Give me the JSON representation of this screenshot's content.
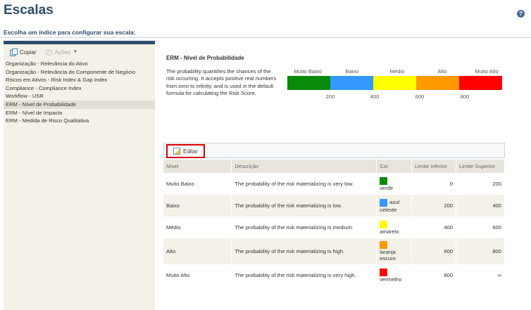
{
  "header": {
    "title": "Escalas",
    "subtitle": "Escolha um índice para configurar sua escala:",
    "help_glyph": "?"
  },
  "toolbar": {
    "copy_label": "Copiar",
    "actions_label": "Ações",
    "actions_glyph": "»",
    "caret_glyph": "▼"
  },
  "sidebar": {
    "items": [
      "Organização - Relevância do Ativo",
      "Organização - Relevância do Componente de Negócio",
      "Riscos em Ativos - Risk Index & Gap Index",
      "Compliance - Compliance Index",
      "Workflow - USR",
      "ERM - Nível de Probabilidade",
      "ERM - Nível de Impacto",
      "ERM - Medida de Risco Qualitativa"
    ],
    "selected_index": 5
  },
  "scale": {
    "title": "ERM - Nível de Probabilidade",
    "description": "The probability quantifies the chances of the risk occurring. It accepts positive real numbers from zero to infinity, and is used in the default formula for calculating the Risk Score.",
    "labels": [
      "Muito Baixo",
      "Baixo",
      "Médio",
      "Alto",
      "Muito Alto"
    ],
    "colors": [
      "#0a8a0a",
      "#3399ff",
      "#ffff00",
      "#ff9900",
      "#ff0000"
    ],
    "ticks": [
      "200",
      "400",
      "600",
      "800"
    ]
  },
  "grid": {
    "edit_label": "Editar",
    "columns": [
      "Nível",
      "Descrição",
      "Cor",
      "Limite Inferior",
      "Limite Superior"
    ],
    "rows": [
      {
        "level": "Muito Baixo",
        "description": "The probability of the risk materializing is very low.",
        "color_name": "verde",
        "color_hex": "#0a8a0a",
        "lower": "0",
        "upper": "200"
      },
      {
        "level": "Baixo",
        "description": "The probability of the risk materializing is low.",
        "color_name": "azul celeste",
        "color_hex": "#3399ff",
        "lower": "200",
        "upper": "400"
      },
      {
        "level": "Médio",
        "description": "The probability of the risk materializing is medium.",
        "color_name": "amarelo",
        "color_hex": "#ffff00",
        "lower": "400",
        "upper": "600"
      },
      {
        "level": "Alto",
        "description": "The probability of the risk materializing is high.",
        "color_name": "laranja escuro",
        "color_hex": "#ff9900",
        "lower": "600",
        "upper": "800"
      },
      {
        "level": "Muito Alto",
        "description": "The probability of the risk materializing is very high.",
        "color_name": "vermelho",
        "color_hex": "#ff0000",
        "lower": "800",
        "upper": "∞"
      }
    ]
  }
}
